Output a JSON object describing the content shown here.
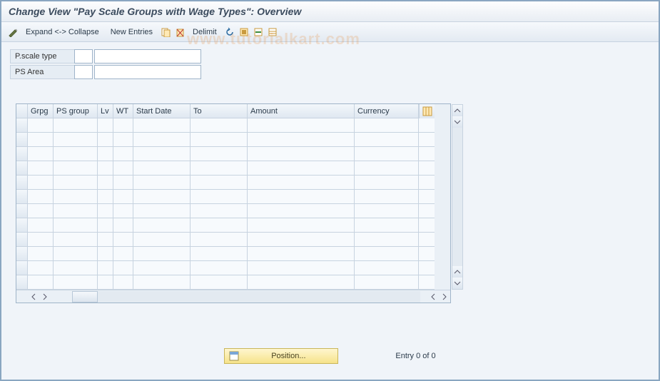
{
  "title": "Change View \"Pay Scale Groups with Wage Types\": Overview",
  "toolbar": {
    "expand_collapse": "Expand <-> Collapse",
    "new_entries": "New Entries",
    "delimit": "Delimit"
  },
  "form": {
    "pscale_type_label": "P.scale type",
    "pscale_type_small": "",
    "pscale_type_value": "",
    "ps_area_label": "PS Area",
    "ps_area_small": "",
    "ps_area_value": ""
  },
  "table": {
    "columns": [
      "Grpg",
      "PS group",
      "Lv",
      "WT",
      "Start Date",
      "To",
      "Amount",
      "Currency"
    ]
  },
  "footer": {
    "position_btn": "Position...",
    "entry_text": "Entry 0 of 0"
  },
  "watermark": "www.tutorialkart.com"
}
